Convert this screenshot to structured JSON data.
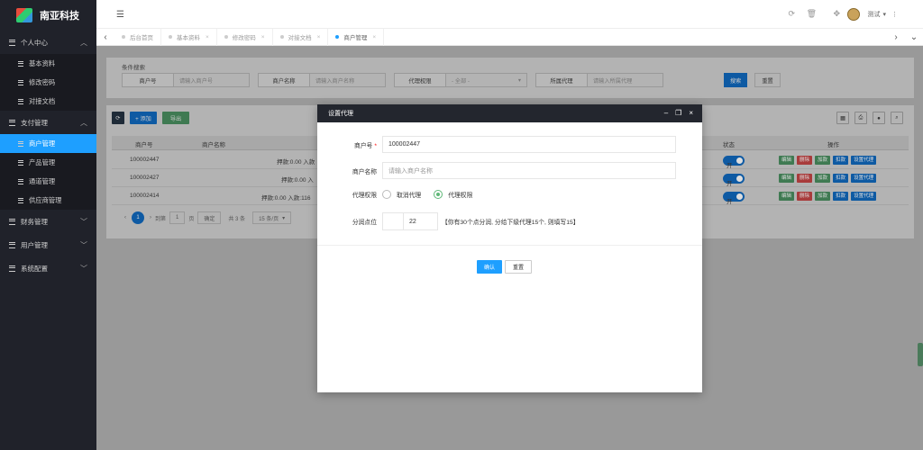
{
  "app": {
    "title": "南亚科技"
  },
  "sidebar": {
    "groups": [
      {
        "label": "个人中心",
        "expanded": true,
        "items": [
          "基本资料",
          "修改密码",
          "对接文档"
        ]
      },
      {
        "label": "支付管理",
        "expanded": true,
        "items": [
          "商户管理",
          "产品管理",
          "通道管理",
          "供应商管理"
        ],
        "active": "商户管理"
      },
      {
        "label": "财务管理",
        "expanded": false
      },
      {
        "label": "用户管理",
        "expanded": false
      },
      {
        "label": "系统配置",
        "expanded": false
      }
    ]
  },
  "header": {
    "user": "测试"
  },
  "tabs": [
    {
      "label": "后台首页"
    },
    {
      "label": "基本资料"
    },
    {
      "label": "修改密码"
    },
    {
      "label": "对接文档"
    },
    {
      "label": "商户管理",
      "active": true
    }
  ],
  "search": {
    "title": "条件搜索",
    "fields": [
      {
        "label": "商户号",
        "placeholder": "请输入商户号"
      },
      {
        "label": "商户名称",
        "placeholder": "请输入商户名称"
      },
      {
        "label": "代理权限",
        "placeholder": "- 全部 -"
      },
      {
        "label": "所属代理",
        "placeholder": "请输入所属代理"
      }
    ],
    "search_btn": "搜索",
    "reset_btn": "重置"
  },
  "toolbar": {
    "add": "+ 添加",
    "export": "导出"
  },
  "table": {
    "headers": {
      "merchant_no": "商户号",
      "merchant_name": "商户名称",
      "status": "状态",
      "ops": "操作"
    },
    "rows": [
      {
        "merchant_no": "100002447",
        "summary": "押款:0.00 入款",
        "status": "开",
        "ops": [
          "编辑",
          "删除",
          "加款",
          "扣款",
          "设置代理"
        ]
      },
      {
        "merchant_no": "100002427",
        "summary": "押款:0.00 入",
        "status": "开",
        "ops": [
          "编辑",
          "删除",
          "加款",
          "扣款",
          "设置代理"
        ]
      },
      {
        "merchant_no": "100002414",
        "summary": "押款:0.00 入款:116",
        "status": "开",
        "ops": [
          "编辑",
          "删除",
          "加款",
          "扣款",
          "设置代理"
        ]
      }
    ]
  },
  "pager": {
    "current": "1",
    "goto": "到第",
    "page_input": "1",
    "page_unit": "页",
    "confirm": "确定",
    "total": "共 3 条",
    "per_page": "15 条/页"
  },
  "modal": {
    "title": "设置代理",
    "merchant_no_label": "商户号",
    "merchant_no_value": "100002447",
    "merchant_name_label": "商户名称",
    "merchant_name_placeholder": "请输入商户名称",
    "agent_label": "代理权限",
    "agent_opt_cancel": "取消代理",
    "agent_opt_grant": "代理权限",
    "rate_label": "分润点位",
    "rate_value": "22",
    "rate_hint": "【你有30个点分润, 分给下级代理15个, 则填写15】",
    "confirm": "确认",
    "reset": "重置"
  },
  "colors": {
    "sidebar": "#20222a",
    "active": "#1e9fff",
    "green": "#5fb878",
    "modal_head": "#23262e"
  }
}
